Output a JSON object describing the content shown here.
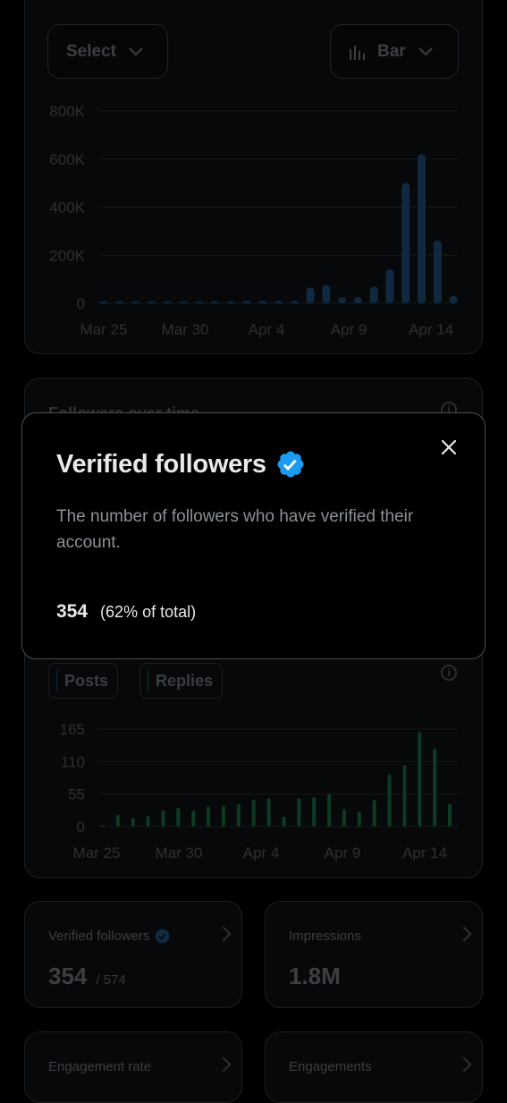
{
  "top_chart": {
    "select_label": "Select",
    "chart_type_label": "Bar",
    "y_ticks": [
      "800K",
      "600K",
      "400K",
      "200K",
      "0"
    ],
    "x_ticks": [
      "Mar 25",
      "Mar 30",
      "Apr 4",
      "Apr 9",
      "Apr 14"
    ]
  },
  "followers_card": {
    "title": "Followers over time"
  },
  "activity_chart": {
    "legend_posts": "Posts",
    "legend_replies": "Replies",
    "y_ticks": [
      "165",
      "110",
      "55",
      "0"
    ],
    "x_ticks": [
      "Mar 25",
      "Mar 30",
      "Apr 4",
      "Apr 9",
      "Apr 14"
    ]
  },
  "stats": {
    "verified_title": "Verified followers",
    "verified_value": "354",
    "verified_total": "/ 574",
    "impressions_title": "Impressions",
    "impressions_value": "1.8M",
    "engagement_rate_title": "Engagement rate",
    "engagements_title": "Engagements"
  },
  "modal": {
    "title": "Verified followers",
    "description": "The number of followers who have verified their account.",
    "value": "354",
    "percent": "(62% of total)"
  },
  "colors": {
    "accent": "#1d9bf0",
    "posts_bar": "#0f2a40",
    "replies_bar": "#0c3a22"
  },
  "chart_data": [
    {
      "type": "bar",
      "y_ticks": [
        "800K",
        "600K",
        "400K",
        "200K",
        "0"
      ],
      "ylim": [
        0,
        800000
      ],
      "x_tick_labels": [
        "Mar 25",
        "Mar 30",
        "Apr 4",
        "Apr 9",
        "Apr 14"
      ],
      "series": [
        {
          "values": [
            5000,
            5000,
            5000,
            5000,
            5000,
            5000,
            5000,
            5000,
            5000,
            10000,
            10000,
            10000,
            10000,
            65000,
            75000,
            25000,
            25000,
            70000,
            140000,
            500000,
            620000,
            260000,
            30000
          ]
        }
      ]
    },
    {
      "type": "bar",
      "y_ticks": [
        "165",
        "110",
        "55",
        "0"
      ],
      "ylim": [
        0,
        165
      ],
      "x_tick_labels": [
        "Mar 25",
        "Mar 30",
        "Apr 4",
        "Apr 9",
        "Apr 14"
      ],
      "series": [
        {
          "name": "Posts",
          "values": [
            0,
            0,
            0,
            0,
            0,
            0,
            0,
            0,
            0,
            0,
            0,
            0,
            0,
            0,
            0,
            0,
            0,
            0,
            0,
            0,
            0,
            0,
            0
          ]
        },
        {
          "name": "Replies",
          "values": [
            2,
            20,
            15,
            18,
            28,
            32,
            27,
            34,
            35,
            38,
            46,
            48,
            17,
            48,
            50,
            55,
            30,
            25,
            45,
            88,
            104,
            160,
            132,
            38
          ]
        }
      ]
    }
  ]
}
